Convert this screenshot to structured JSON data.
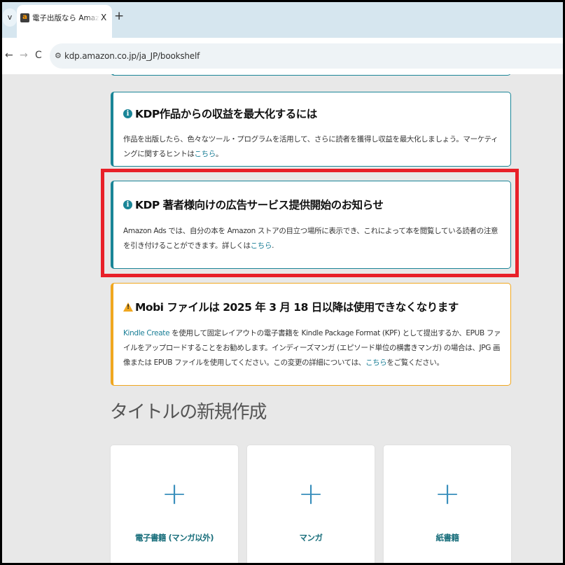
{
  "browser": {
    "tab_menu_icon": "v",
    "tab_title": "電子出版なら Amazon Kindle ダイレクト・パブリッシング",
    "tab_close": "X",
    "new_tab": "+",
    "back_icon": "←",
    "forward_icon": "→",
    "reload_icon": "C",
    "site_info_icon": "⚙",
    "url": "kdp.amazon.co.jp/ja_JP/bookshelf",
    "favicon_letter": "a"
  },
  "alerts": [
    {
      "icon": "i",
      "title": "KDP作品からの収益を最大化するには",
      "body": "作品を出版したら、色々なツール・プログラムを活用して、さらに読者を獲得し収益を最大化しましょう。マーケティングに関するヒントは",
      "link": "こちら",
      "tail": "。"
    },
    {
      "icon": "i",
      "title": "KDP 著者様向けの広告サービス提供開始のお知らせ",
      "body": "Amazon Ads では、自分の本を Amazon ストアの目立つ場所に表示でき、これによって本を閲覧している読者の注意を引き付けることができます。詳しくは",
      "link": "こちら",
      "tail": "."
    },
    {
      "icon": "!",
      "title": "Mobi ファイルは 2025 年 3 月 18 日以降は使用できなくなります",
      "link_lead": "Kindle Create",
      "body": " を使用して固定レイアウトの電子書籍を Kindle Package Format (KPF) として提出するか、EPUB ファイルをアップロードすることをお勧めします。インディーズマンガ (エピソード単位の横書きマンガ) の場合は、JPG 画像または EPUB ファイルを使用してください。この変更の詳細については、",
      "link": "こちら",
      "tail": "をご覧ください。"
    }
  ],
  "new_title": {
    "heading": "タイトルの新規作成",
    "plus": "+",
    "cards": [
      {
        "label": "電子書籍 (マンガ以外)"
      },
      {
        "label": "マンガ"
      },
      {
        "label": "紙書籍"
      }
    ]
  },
  "colors": {
    "info_border": "#1a8597",
    "warning_border": "#f0a71f",
    "highlight": "#e82029",
    "link": "#1a7e96"
  }
}
